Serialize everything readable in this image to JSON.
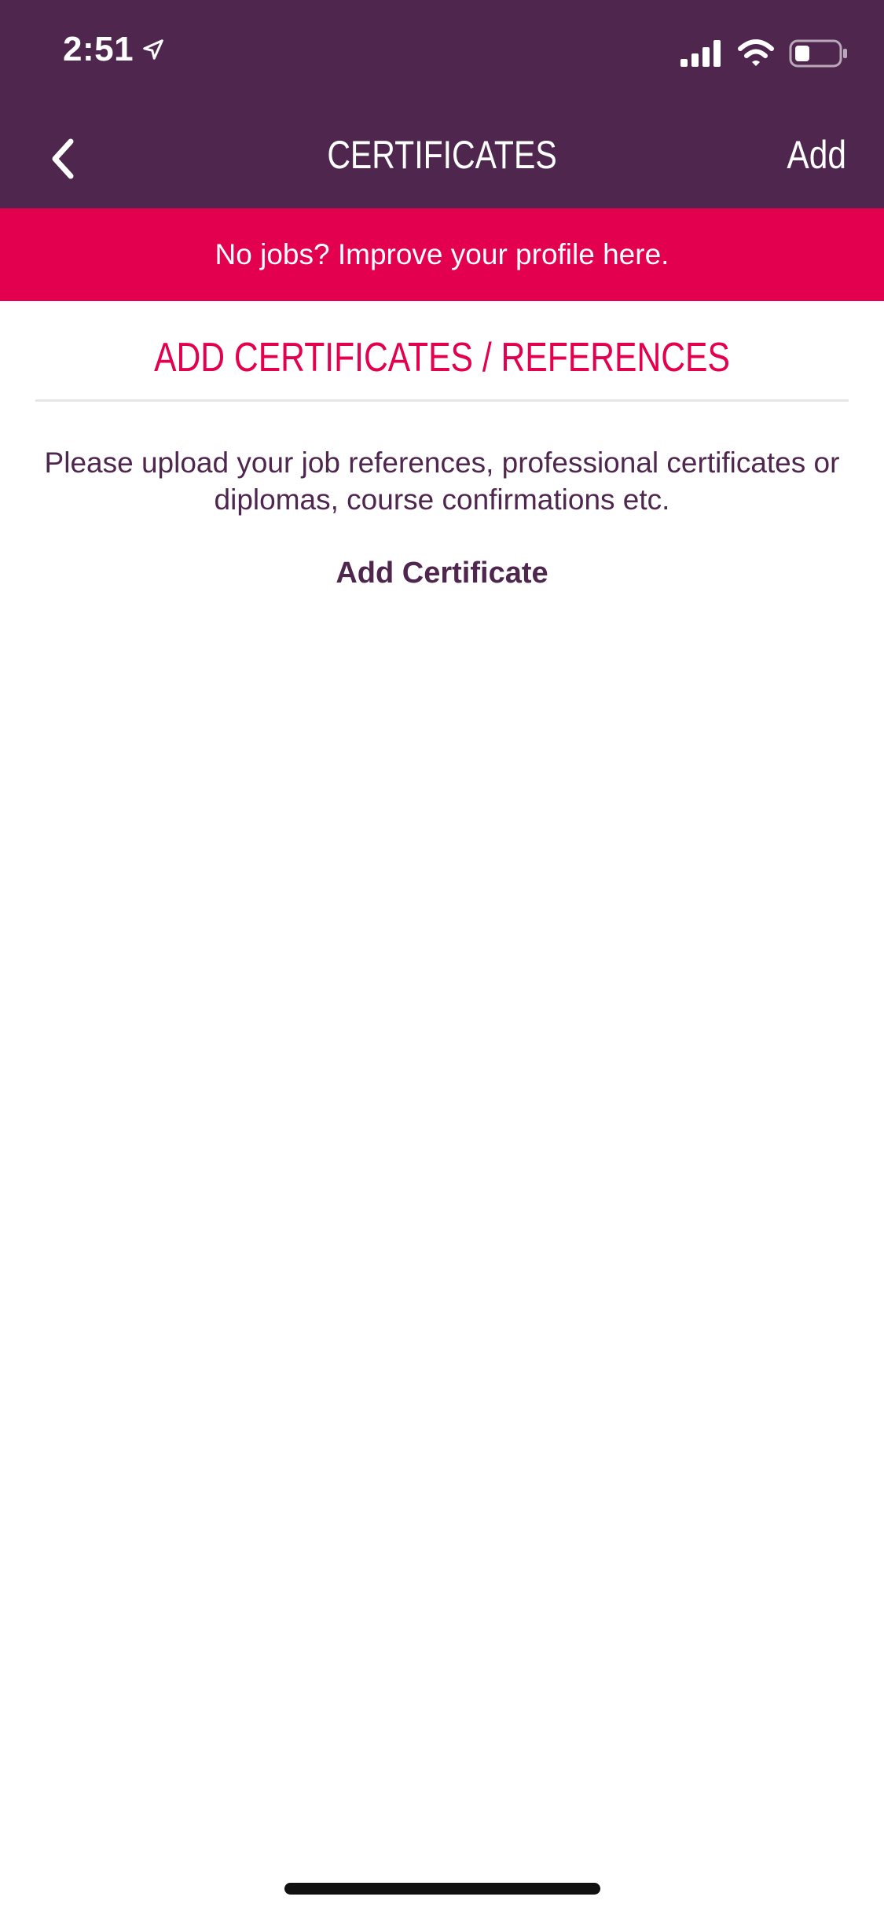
{
  "status_bar": {
    "time": "2:51"
  },
  "nav": {
    "title": "CERTIFICATES",
    "add_label": "Add"
  },
  "banner": {
    "text": "No jobs? Improve your profile here."
  },
  "content": {
    "heading": "ADD CERTIFICATES / REFERENCES",
    "description": "Please upload your job references, professional certificates or diplomas, course confirmations etc.",
    "add_certificate_label": "Add Certificate"
  },
  "colors": {
    "header_bg": "#4f274e",
    "accent": "#e3004f",
    "text_primary": "#4f274e"
  }
}
